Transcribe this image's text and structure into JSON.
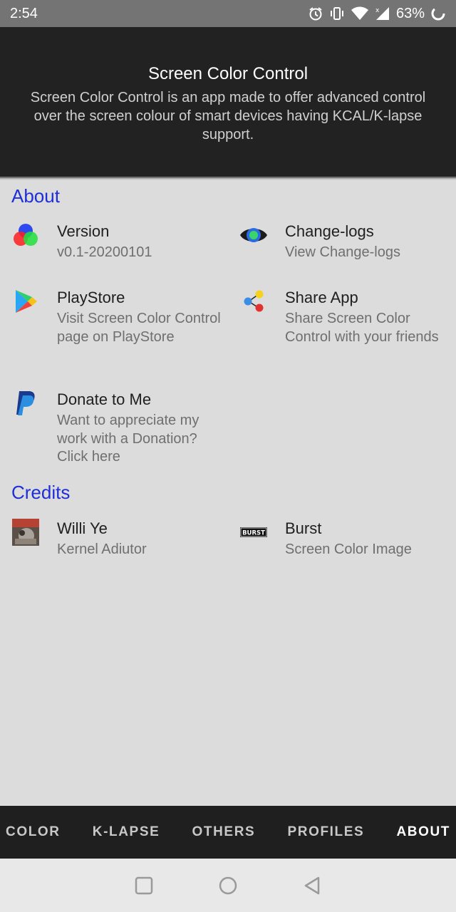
{
  "status": {
    "time": "2:54",
    "battery": "63%"
  },
  "header": {
    "title": "Screen Color Control",
    "description": "Screen Color Control is an app made to offer advanced control over the screen colour of smart devices having KCAL/K-lapse support."
  },
  "about": {
    "heading": "About",
    "items": [
      {
        "title": "Version",
        "subtitle": "v0.1-20200101",
        "icon": "rgb-circles-icon"
      },
      {
        "title": "Change-logs",
        "subtitle": "View Change-logs",
        "icon": "eye-icon"
      },
      {
        "title": "PlayStore",
        "subtitle": "Visit Screen Color Control page on PlayStore",
        "icon": "playstore-icon"
      },
      {
        "title": "Share App",
        "subtitle": "Share Screen Color Control with your friends",
        "icon": "share-icon"
      },
      {
        "title": "Donate to Me",
        "subtitle": "Want to appreciate my work with a Donation? Click here",
        "icon": "paypal-icon"
      }
    ]
  },
  "credits": {
    "heading": "Credits",
    "items": [
      {
        "title": "Willi Ye",
        "subtitle": "Kernel Adiutor",
        "icon": "avatar-photo"
      },
      {
        "title": "Burst",
        "subtitle": "Screen Color Image",
        "icon": "burst-logo",
        "logo_text": "BURST"
      }
    ]
  },
  "tabs": [
    "COLOR",
    "K-LAPSE",
    "OTHERS",
    "PROFILES",
    "ABOUT"
  ],
  "colors": {
    "accent": "#1e2fd8",
    "header_bg": "#222222",
    "content_bg": "#dcdcdc",
    "tabbar_bg": "#1f1f1f"
  }
}
